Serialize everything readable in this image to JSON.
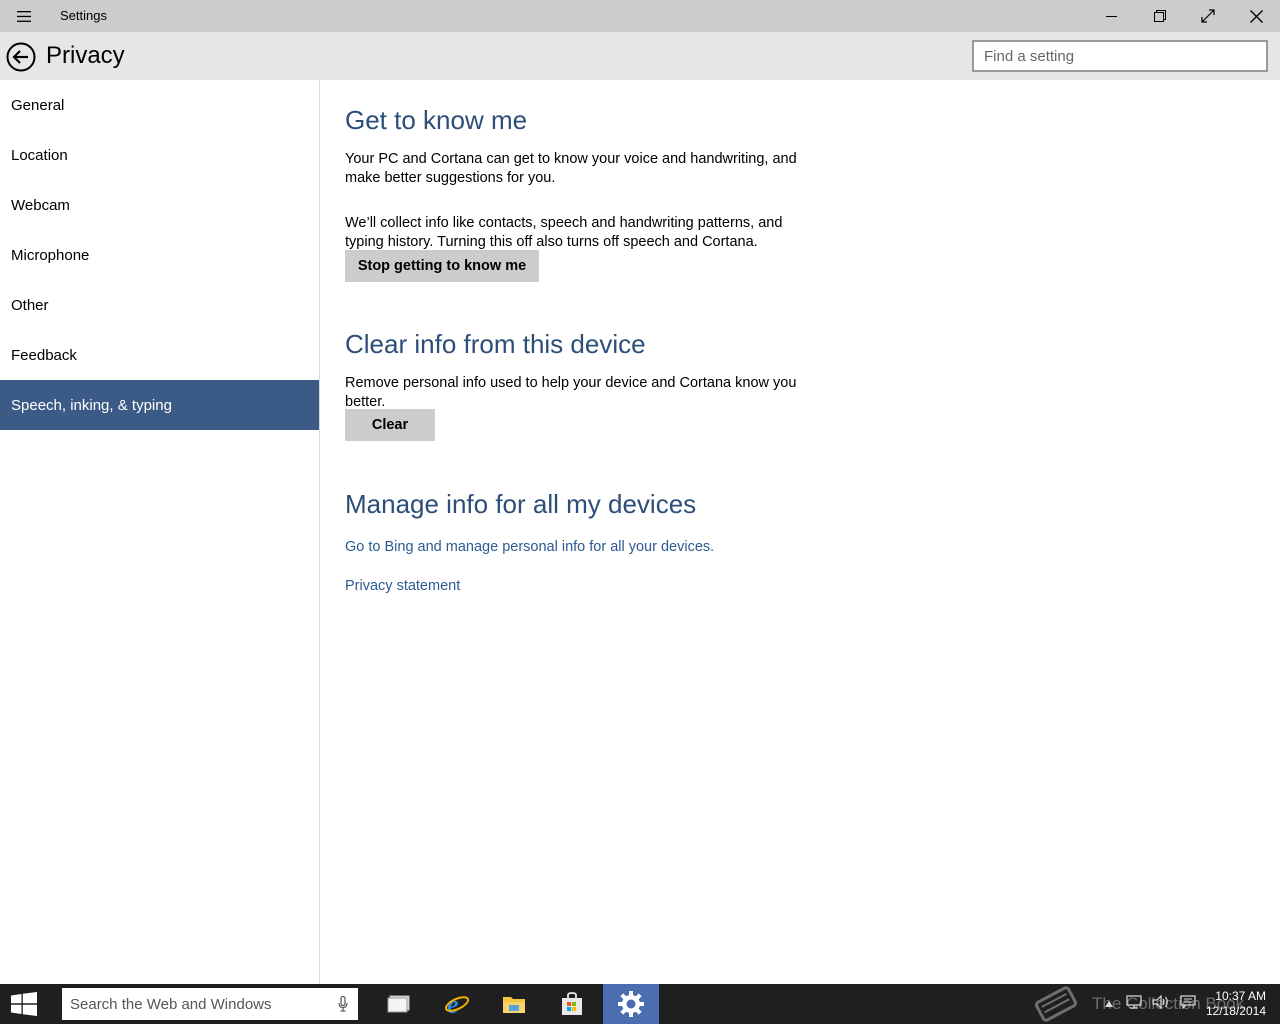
{
  "titlebar": {
    "app_title": "Settings"
  },
  "header": {
    "title": "Privacy",
    "search_placeholder": "Find a setting"
  },
  "sidebar": {
    "items": [
      {
        "label": "General"
      },
      {
        "label": "Location"
      },
      {
        "label": "Webcam"
      },
      {
        "label": "Microphone"
      },
      {
        "label": "Other"
      },
      {
        "label": "Feedback"
      },
      {
        "label": "Speech, inking, & typing",
        "selected": true
      }
    ]
  },
  "main": {
    "know_me": {
      "title": "Get to know me",
      "para1": "Your PC and Cortana can get to know your voice and handwriting, and make better suggestions for you.",
      "para2": "We’ll collect info like contacts, speech and handwriting patterns, and typing history. Turning this off also turns off speech and Cortana.",
      "button": "Stop getting to know me"
    },
    "clear": {
      "title": "Clear info from this device",
      "para": "Remove personal info used to help your device and Cortana know you better.",
      "button": "Clear"
    },
    "manage": {
      "title": "Manage info for all my devices",
      "link": "Go to Bing and manage personal info for all your devices.",
      "privacy_link": "Privacy statement"
    }
  },
  "taskbar": {
    "search_placeholder": "Search the Web and Windows",
    "watermark": "The Collection Book",
    "time": "10:37 AM",
    "date": "12/18/2014"
  },
  "colors": {
    "accent": "#3b5b86",
    "heading": "#2d4e78",
    "link": "#2d5a91",
    "titlebar": "#cccccc",
    "header": "#e6e6e6",
    "taskbar": "#1f1f1f",
    "taskbar_active": "#4a6eb0"
  }
}
